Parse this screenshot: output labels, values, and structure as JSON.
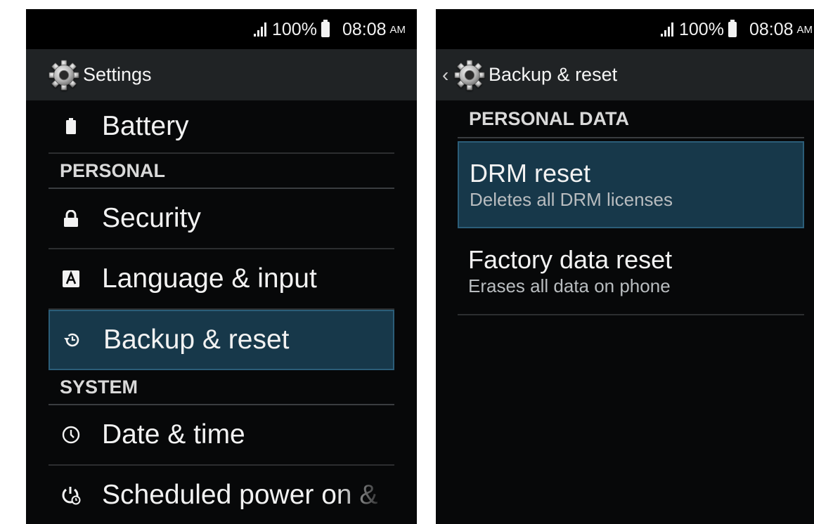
{
  "status_bar": {
    "battery": "100%",
    "time": "08:08",
    "ampm": "AM"
  },
  "settings_screen": {
    "title": "Settings",
    "items_top": [
      {
        "label": "Battery",
        "icon": "battery-icon"
      }
    ],
    "sections": [
      {
        "header": "PERSONAL",
        "items": [
          {
            "label": "Security",
            "icon": "lock-icon"
          },
          {
            "label": "Language & input",
            "icon": "language-icon"
          },
          {
            "label": "Backup & reset",
            "icon": "backup-restore-icon",
            "selected": true
          }
        ]
      },
      {
        "header": "SYSTEM",
        "items": [
          {
            "label": "Date & time",
            "icon": "clock-icon"
          },
          {
            "label": "Scheduled power on &",
            "icon": "scheduled-power-icon"
          }
        ]
      }
    ]
  },
  "backup_screen": {
    "title": "Backup & reset",
    "section": "PERSONAL DATA",
    "items": [
      {
        "title": "DRM reset",
        "subtitle": "Deletes all DRM licenses",
        "selected": true
      },
      {
        "title": "Factory data reset",
        "subtitle": "Erases all data on phone"
      }
    ]
  },
  "colors": {
    "background": "#070809",
    "action_bar": "#202325",
    "highlight": "#17384a",
    "highlight_border": "#2b5d78",
    "divider": "#2c2e30"
  }
}
